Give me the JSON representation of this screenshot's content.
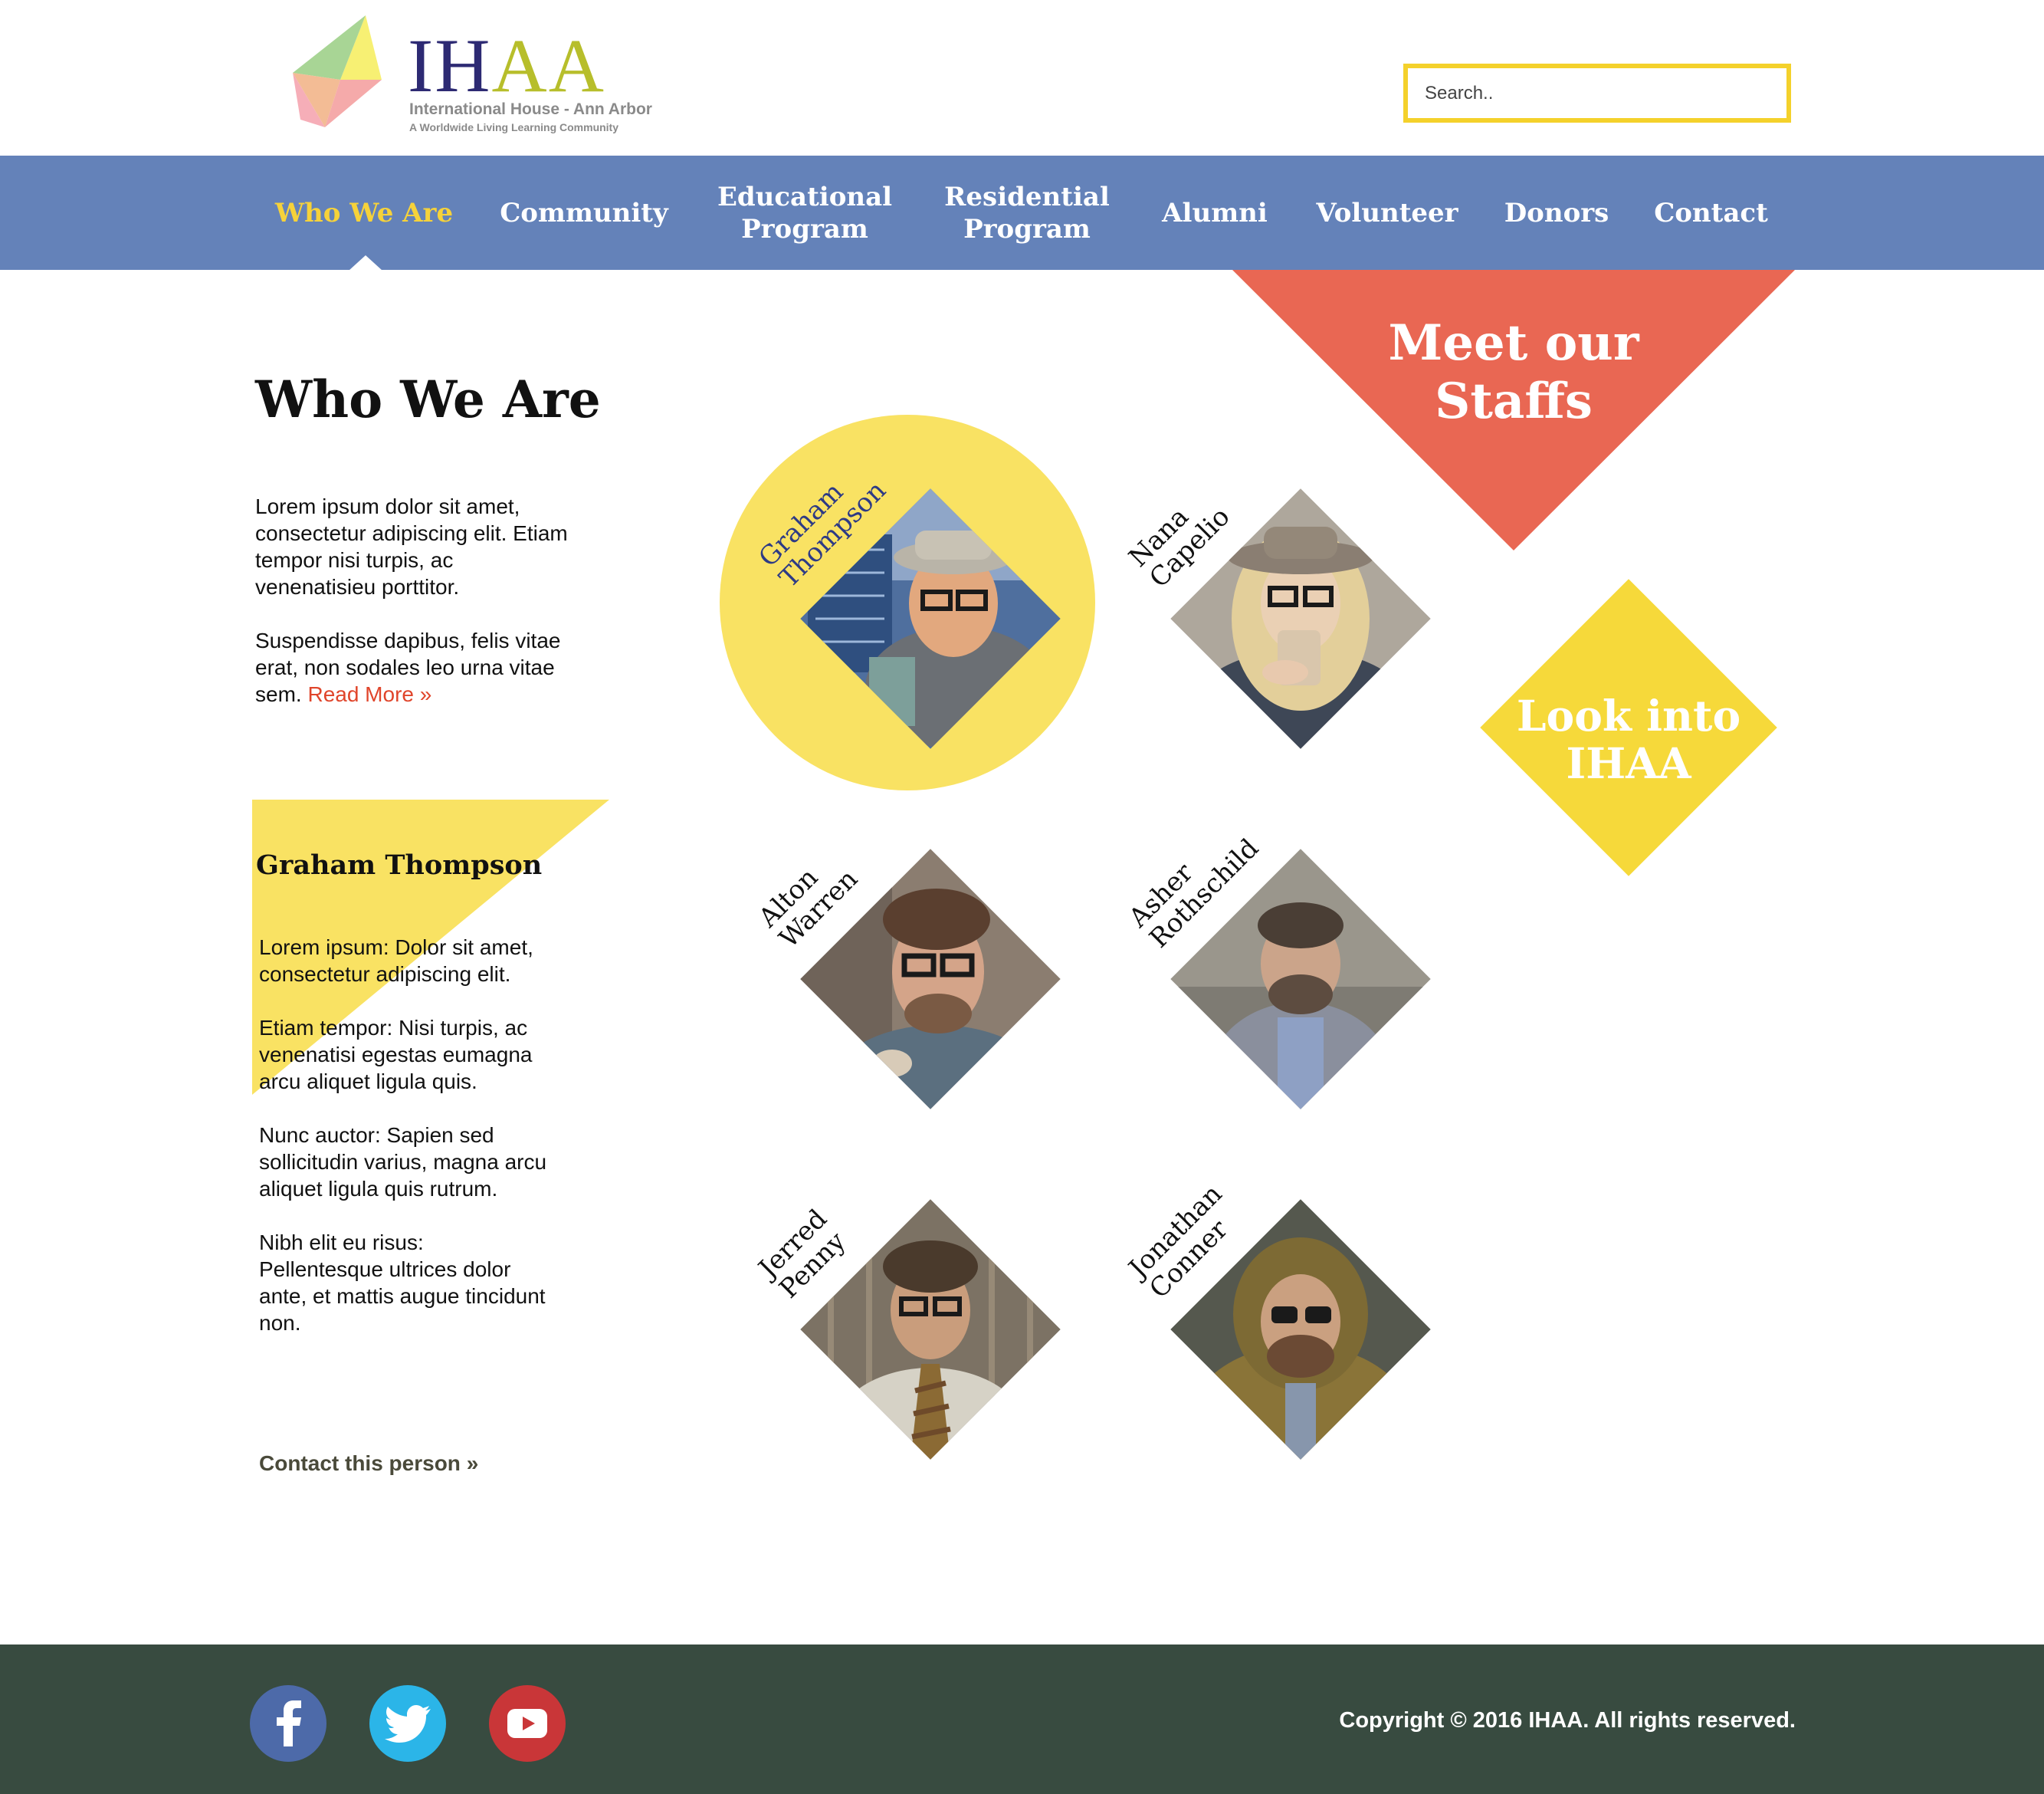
{
  "brand": {
    "wordmark_a": "IH",
    "wordmark_b": "AA",
    "subtitle": "International House - Ann Arbor",
    "tagline": "A Worldwide Living Learning Community",
    "colors": {
      "navy": "#2d2a73",
      "olive": "#b7be2b",
      "nav": "#6482b9",
      "yellow": "#f6d93a",
      "coral": "#e96753",
      "footer": "#384b40"
    }
  },
  "search": {
    "placeholder": "Search.."
  },
  "nav": {
    "items": [
      {
        "label": "Who We Are",
        "active": true
      },
      {
        "label": "Community"
      },
      {
        "label": "Educational\nProgram"
      },
      {
        "label": "Residential\nProgram"
      },
      {
        "label": "Alumni"
      },
      {
        "label": "Volunteer"
      },
      {
        "label": "Donors"
      },
      {
        "label": "Contact"
      }
    ]
  },
  "main": {
    "title": "Who We Are",
    "intro_p1": "Lorem ipsum dolor sit amet, consectetur adipiscing elit. Etiam tempor nisi turpis, ac venenatisieu porttitor.",
    "intro_p2": "Suspendisse dapibus, felis vitae erat, non sodales leo urna vitae sem.",
    "read_more": "Read More »"
  },
  "profile": {
    "name": "Graham Thompson",
    "p1": "Lorem ipsum: Dolor sit amet, consectetur adipiscing elit.",
    "p2": "Etiam tempor: Nisi turpis, ac venenatisi egestas eumagna arcu aliquet ligula quis.",
    "p3": "Nunc auctor: Sapien sed sollicitudin varius, magna arcu aliquet ligula quis rutrum.",
    "p4": "Nibh elit eu risus: Pellentesque ultrices dolor ante, et mattis augue tincidunt non.",
    "contact": "Contact this person »"
  },
  "staff": [
    {
      "name": "Graham\nThompson",
      "selected": true
    },
    {
      "name": "Nana\nCapelio"
    },
    {
      "name": "Alton\nWarren"
    },
    {
      "name": "Asher\nRothschild"
    },
    {
      "name": "Jerred\nPenny"
    },
    {
      "name": "Jonathan\nConner"
    }
  ],
  "promo": {
    "meet": "Meet our\nStaffs",
    "look": "Look into\nIHAA"
  },
  "footer": {
    "social": [
      "facebook-icon",
      "twitter-icon",
      "youtube-icon"
    ],
    "copyright": "Copyright © 2016 IHAA. All rights reserved."
  }
}
